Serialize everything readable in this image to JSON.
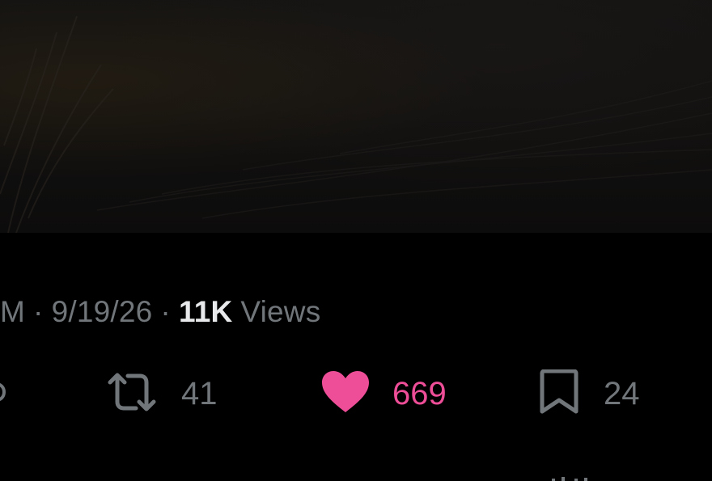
{
  "tweet": {
    "meta": {
      "time_fragment": "M",
      "separator": "·",
      "date": "9/19/26",
      "views_count": "11K",
      "views_label": "Views"
    },
    "actions": {
      "retweets": "41",
      "likes": "669",
      "bookmarks": "24"
    }
  },
  "colors": {
    "background": "#000000",
    "secondary_text": "#71767b",
    "primary_text": "#e7e9ea",
    "like_active": "#ee4d97"
  },
  "icons": {
    "reply": "reply-icon",
    "retweet": "retweet-icon",
    "like": "heart-icon",
    "bookmark": "bookmark-icon"
  }
}
